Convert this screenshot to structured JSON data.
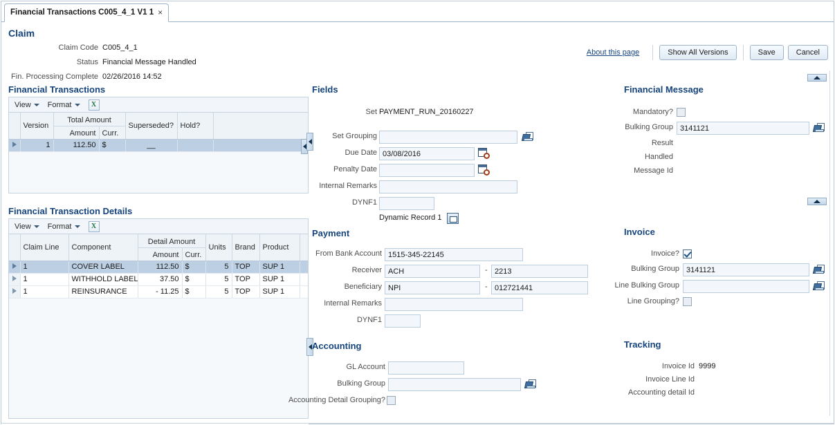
{
  "tab": {
    "label": "Financial Transactions C005_4_1 V1 1",
    "close_glyph": "×"
  },
  "header": {
    "title": "Claim",
    "about_link": "About this page",
    "buttons": {
      "show_all_versions": "Show All Versions",
      "save": "Save",
      "cancel": "Cancel"
    },
    "fields": [
      {
        "label": "Claim Code",
        "value": "C005_4_1"
      },
      {
        "label": "Status",
        "value": "Financial Message Handled"
      },
      {
        "label": "Fin. Processing Complete",
        "value": "02/26/2016 14:52"
      }
    ]
  },
  "financial_transactions": {
    "title": "Financial Transactions",
    "toolbar": {
      "view": "View",
      "format": "Format",
      "export_icon": "excel-export-icon"
    },
    "columns": [
      {
        "label": "Version"
      },
      {
        "label": "Total Amount",
        "sub": [
          "Amount",
          "Curr."
        ]
      },
      {
        "label": "Superseded?"
      },
      {
        "label": "Hold?"
      }
    ],
    "rows": [
      {
        "version": "1",
        "amount": "112.50",
        "curr": "$",
        "superseded": "__",
        "hold": "",
        "selected": true
      }
    ]
  },
  "financial_transaction_details": {
    "title": "Financial Transaction Details",
    "toolbar": {
      "view": "View",
      "format": "Format",
      "export_icon": "excel-export-icon"
    },
    "columns": [
      {
        "label": "Claim Line"
      },
      {
        "label": "Component"
      },
      {
        "label": "Detail Amount",
        "sub": [
          "Amount",
          "Curr."
        ]
      },
      {
        "label": "Units"
      },
      {
        "label": "Brand"
      },
      {
        "label": "Product"
      }
    ],
    "rows": [
      {
        "claim_line": "1",
        "component": "COVER LABEL",
        "amount": "112.50",
        "curr": "$",
        "units": "5",
        "brand": "TOP",
        "product": "SUP 1",
        "selected": true
      },
      {
        "claim_line": "1",
        "component": "WITHHOLD LABEL",
        "amount": "37.50",
        "curr": "$",
        "units": "5",
        "brand": "TOP",
        "product": "SUP 1",
        "selected": false
      },
      {
        "claim_line": "1",
        "component": "REINSURANCE",
        "amount": "- 11.25",
        "curr": "$",
        "units": "5",
        "brand": "TOP",
        "product": "SUP 1",
        "selected": false
      }
    ]
  },
  "fields_section": {
    "title": "Fields",
    "set_label": "Set",
    "set_value": "PAYMENT_RUN_20160227",
    "set_grouping_label": "Set Grouping",
    "set_grouping_value": "",
    "due_date_label": "Due Date",
    "due_date_value": "03/08/2016",
    "penalty_date_label": "Penalty Date",
    "penalty_date_value": "",
    "internal_remarks_label": "Internal Remarks",
    "internal_remarks_value": "",
    "dynf1_label": "DYNF1",
    "dynf1_value": "",
    "dynamic_record_label": "Dynamic Record 1"
  },
  "payment_section": {
    "title": "Payment",
    "from_bank_account_label": "From Bank Account",
    "from_bank_account_value": "1515-345-22145",
    "receiver_label": "Receiver",
    "receiver_value": "ACH",
    "receiver_sep": "-",
    "receiver_value2": "2213",
    "beneficiary_label": "Beneficiary",
    "beneficiary_value": "NPI",
    "beneficiary_sep": "-",
    "beneficiary_value2": "012721441",
    "internal_remarks_label": "Internal Remarks",
    "internal_remarks_value": "",
    "dynf1_label": "DYNF1",
    "dynf1_value": ""
  },
  "accounting_section": {
    "title": "Accounting",
    "gl_account_label": "GL Account",
    "gl_account_value": "",
    "bulking_group_label": "Bulking Group",
    "bulking_group_value": "",
    "detail_grouping_label": "Accounting Detail Grouping?",
    "detail_grouping_checked": false
  },
  "financial_message_section": {
    "title": "Financial Message",
    "mandatory_label": "Mandatory?",
    "mandatory_checked": false,
    "bulking_group_label": "Bulking Group",
    "bulking_group_value": "3141121",
    "result_label": "Result",
    "result_value": "",
    "handled_label": "Handled",
    "handled_value": "",
    "message_id_label": "Message Id",
    "message_id_value": ""
  },
  "invoice_section": {
    "title": "Invoice",
    "invoice_label": "Invoice?",
    "invoice_checked": true,
    "bulking_group_label": "Bulking Group",
    "bulking_group_value": "3141121",
    "line_bulking_group_label": "Line Bulking Group",
    "line_bulking_group_value": "",
    "line_grouping_label": "Line Grouping?",
    "line_grouping_checked": false
  },
  "tracking_section": {
    "title": "Tracking",
    "invoice_id_label": "Invoice Id",
    "invoice_id_value": "9999",
    "invoice_line_id_label": "Invoice Line Id",
    "invoice_line_id_value": "",
    "accounting_detail_id_label": "Accounting detail Id",
    "accounting_detail_id_value": ""
  },
  "colors": {
    "heading": "#15447e",
    "selected_row": "#bdcfe2",
    "field_bg": "#f3f7fb",
    "border": "#c5d3e1"
  }
}
